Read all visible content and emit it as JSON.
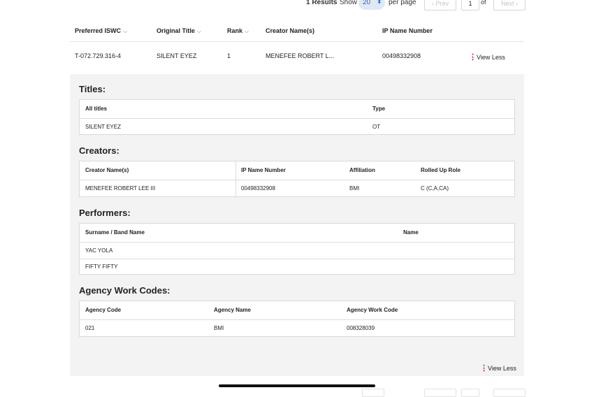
{
  "pagination": {
    "results": "1 Results",
    "show_label": "Show",
    "per_page_value": "20",
    "per_page_label": "per page",
    "prev": "‹ Prev",
    "page": "1",
    "of": "of",
    "next": "Next ›"
  },
  "results_table": {
    "headers": [
      "Preferred ISWC",
      "Original Title",
      "Rank",
      "Creator Name(s)",
      "IP Name Number"
    ],
    "row": {
      "iswc": "T-072.729.316-4",
      "title": "SILENT EYEZ",
      "rank": "1",
      "creator": "MENEFEE ROBERT L...",
      "ip_name_number": "00498332908",
      "action": "View Less"
    }
  },
  "details": {
    "titles": {
      "heading": "Titles:",
      "headers": [
        "All titles",
        "Type"
      ],
      "rows": [
        [
          "SILENT EYEZ",
          "OT"
        ]
      ]
    },
    "creators": {
      "heading": "Creators:",
      "headers": [
        "Creator Name(s)",
        "IP Name Number",
        "Affiliation",
        "Rolled Up Role"
      ],
      "rows": [
        [
          "MENEFEE ROBERT LEE III",
          "00498332908",
          "BMI",
          "C (C,A,CA)"
        ]
      ]
    },
    "performers": {
      "heading": "Performers:",
      "headers": [
        "Surname / Band Name",
        "Name"
      ],
      "rows": [
        [
          "YAC YOLA",
          ""
        ],
        [
          "FIFTY FIFTY",
          ""
        ]
      ]
    },
    "agency_work_codes": {
      "heading": "Agency Work Codes:",
      "headers": [
        "Agency Code",
        "Agency Name",
        "Agency Work Code"
      ],
      "rows": [
        [
          "021",
          "BMI",
          "008328039"
        ]
      ]
    },
    "bottom_action": "View Less"
  },
  "colors": {
    "accent": "#c0262d",
    "panel_bg": "#f3f3f3",
    "select_bg": "#dfe8f5",
    "select_text": "#2a6bd1"
  }
}
